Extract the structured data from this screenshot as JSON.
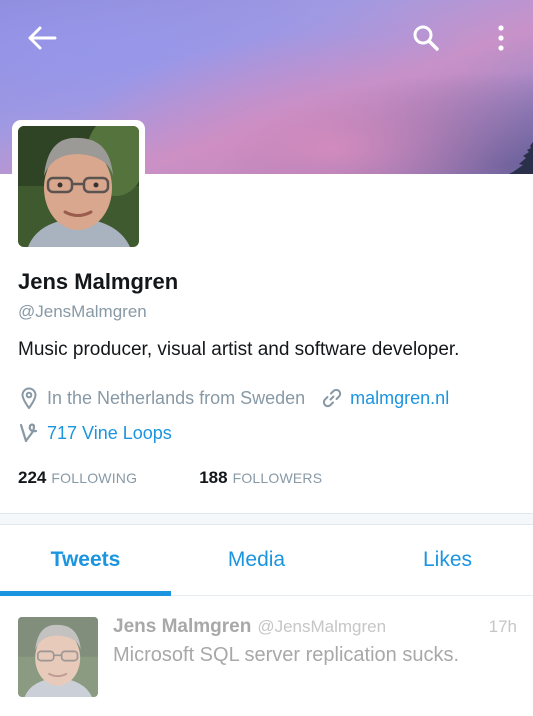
{
  "topbar": {
    "back_icon": "arrow-left-icon",
    "search_icon": "search-icon",
    "more_icon": "more-vertical-icon"
  },
  "profile": {
    "name": "Jens Malmgren",
    "handle": "@JensMalmgren",
    "bio": "Music producer, visual artist and software developer.",
    "location": "In the Netherlands from Sweden",
    "website": "malmgren.nl",
    "vine": "717 Vine Loops",
    "following_count": "224",
    "following_label": "FOLLOWING",
    "followers_count": "188",
    "followers_label": "FOLLOWERS"
  },
  "tabs": [
    {
      "label": "Tweets",
      "active": true
    },
    {
      "label": "Media",
      "active": false
    },
    {
      "label": "Likes",
      "active": false
    }
  ],
  "tweet": {
    "name": "Jens Malmgren",
    "handle": "@JensMalmgren",
    "time": "17h",
    "text": "Microsoft SQL server replication sucks."
  },
  "colors": {
    "accent": "#1b95e0",
    "muted": "#8899a6",
    "text": "#14171a"
  }
}
